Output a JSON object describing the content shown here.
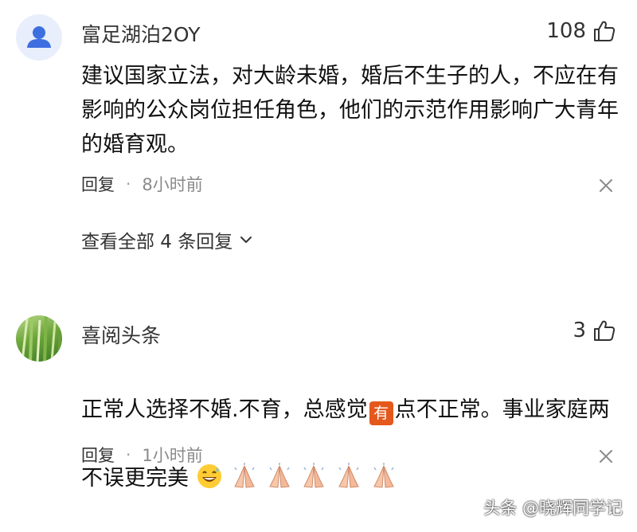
{
  "comments": [
    {
      "username": "富足湖泊2OY",
      "avatar_icon": "default-user-avatar-icon",
      "likes": "108",
      "text": "建议国家立法，对大龄未婚，婚后不生子的人，不应在有\n影响的公众岗位担任角色，他们的示范作用影响广大青年\n的婚育观。",
      "reply_label": "回复",
      "separator": "·",
      "time": "8小时前",
      "expand_label": "查看全部 4 条回复"
    },
    {
      "username": "喜阅头条",
      "avatar_icon": "grass-photo-avatar",
      "likes": "3",
      "text_part1": "正常人选择不婚.不育，总感觉",
      "badge": "有",
      "text_part2": "点不正常。事业家庭两",
      "text_line2": "不误更完美",
      "emojis": [
        "grinning-sweat-emoji",
        "praying-hands-emoji",
        "praying-hands-emoji",
        "praying-hands-emoji",
        "praying-hands-emoji",
        "praying-hands-emoji"
      ],
      "reply_label": "回复",
      "separator": "·",
      "time": "1小时前"
    }
  ],
  "watermark": "头条 @晓辉同学记",
  "colors": {
    "badge": "#e4581c",
    "avatar_bg": "#e8eefb",
    "avatar_fg": "#3d6fe0",
    "meta_time": "#8a8a8a"
  }
}
